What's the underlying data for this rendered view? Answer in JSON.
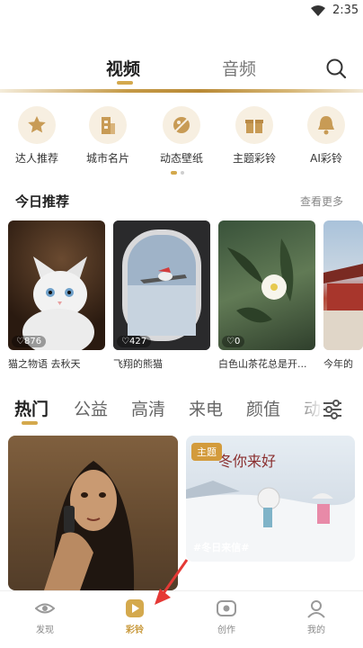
{
  "status_bar": {
    "time": "2:35",
    "wifi_icon": "wifi-icon"
  },
  "top_nav": {
    "tabs": [
      "视频",
      "音频"
    ],
    "active_tab": "视频",
    "search_icon": "search-icon"
  },
  "categories": [
    {
      "label": "达人推荐",
      "icon": "star-badge-icon"
    },
    {
      "label": "城市名片",
      "icon": "building-icon"
    },
    {
      "label": "动态壁纸",
      "icon": "wallpaper-icon"
    },
    {
      "label": "主题彩铃",
      "icon": "gift-icon"
    },
    {
      "label": "AI彩铃",
      "icon": "bell-icon"
    }
  ],
  "today": {
    "title": "今日推荐",
    "more": "查看更多",
    "items": [
      {
        "likes": "876",
        "caption": "猫之物语 去秋天"
      },
      {
        "likes": "427",
        "caption": "飞翔的熊猫"
      },
      {
        "likes": "0",
        "caption": "白色山茶花总是开..."
      },
      {
        "likes": "",
        "caption": "今年的"
      }
    ]
  },
  "content_tabs": {
    "items": [
      "热门",
      "公益",
      "高清",
      "来电",
      "颜值",
      "动"
    ],
    "active": "热门",
    "filter_icon": "filter-sliders-icon"
  },
  "feed": {
    "card2": {
      "badge": "主题",
      "hashtag": "#冬日来信#",
      "art_text": "冬你来好"
    }
  },
  "bottom_nav": {
    "items": [
      {
        "label": "发现",
        "icon": "eye-icon"
      },
      {
        "label": "彩铃",
        "icon": "play-icon"
      },
      {
        "label": "创作",
        "icon": "camera-icon"
      },
      {
        "label": "我的",
        "icon": "profile-icon"
      }
    ],
    "active": "彩铃"
  },
  "colors": {
    "accent": "#d4a94d",
    "active_nav": "#c99a3d",
    "annotation_arrow": "#e53935"
  }
}
